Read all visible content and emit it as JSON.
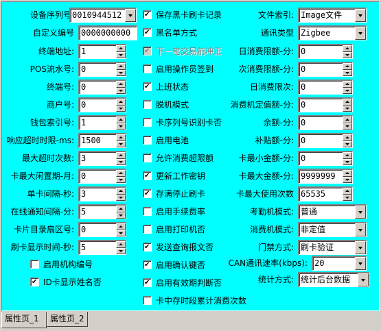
{
  "left_fields": [
    {
      "label": "设备序列号:",
      "value": "0010944512",
      "kind": "dropdown"
    },
    {
      "label": "自定义编号",
      "value": "0000000000",
      "kind": "text"
    },
    {
      "label": "终端地址:",
      "value": "1",
      "kind": "spin"
    },
    {
      "label": "POS流水号:",
      "value": "0",
      "kind": "spin"
    },
    {
      "label": "终端号:",
      "value": "0",
      "kind": "spin"
    },
    {
      "label": "商户号:",
      "value": "0",
      "kind": "spin"
    },
    {
      "label": "钱包索引号:",
      "value": "1",
      "kind": "spin"
    },
    {
      "label": "响应超时时限-ms:",
      "value": "1500",
      "kind": "spin"
    },
    {
      "label": "最大超时次数:",
      "value": "3",
      "kind": "spin"
    },
    {
      "label": "卡最大闲置期-月:",
      "value": "0",
      "kind": "spin"
    },
    {
      "label": "单卡间隔-秒:",
      "value": "3",
      "kind": "spin"
    },
    {
      "label": "在线通知间隔-分:",
      "value": "5",
      "kind": "spin"
    },
    {
      "label": "卡片目录扇区号:",
      "value": "0",
      "kind": "spin"
    },
    {
      "label": "刷卡显示时间-秒:",
      "value": "5",
      "kind": "spin"
    }
  ],
  "left_checkboxes": [
    {
      "label": "启用机构编号",
      "checked": false
    },
    {
      "label": "ID卡显示姓名否",
      "checked": true
    }
  ],
  "mid_checkboxes": [
    {
      "label": "保存黑卡刷卡记录",
      "checked": true,
      "disabled": false
    },
    {
      "label": "黑名单方式",
      "checked": true,
      "disabled": false
    },
    {
      "label": "下一笔交易前冲正",
      "checked": true,
      "disabled": true
    },
    {
      "label": "启用操作员签到",
      "checked": false,
      "disabled": false
    },
    {
      "label": "上班状态",
      "checked": true,
      "disabled": false
    },
    {
      "label": "脱机模式",
      "checked": false,
      "disabled": false
    },
    {
      "label": "卡序列号识别卡否",
      "checked": false,
      "disabled": false
    },
    {
      "label": "启用电池",
      "checked": false,
      "disabled": false
    },
    {
      "label": "允许消费超限额",
      "checked": false,
      "disabled": false
    },
    {
      "label": "更新工作密钥",
      "checked": true,
      "disabled": false
    },
    {
      "label": "存满停止刷卡",
      "checked": true,
      "disabled": false
    },
    {
      "label": "启用手续费率",
      "checked": false,
      "disabled": false
    },
    {
      "label": "启用打印机否",
      "checked": false,
      "disabled": false
    },
    {
      "label": "发送查询报文否",
      "checked": true,
      "disabled": false
    },
    {
      "label": "启用确认键否",
      "checked": true,
      "disabled": false
    },
    {
      "label": "启用有效期判断否",
      "checked": true,
      "disabled": false
    },
    {
      "label": "卡中存时段累计消费次数",
      "checked": false,
      "disabled": false
    }
  ],
  "right_fields": [
    {
      "label": "文件索引:",
      "value": "Image文件",
      "kind": "dropdown"
    },
    {
      "label": "通讯类型",
      "value": "Zigbee",
      "kind": "dropdown"
    },
    {
      "label": "日消费限额-分:",
      "value": "0",
      "kind": "spin"
    },
    {
      "label": "次消费限额-分:",
      "value": "0",
      "kind": "spin"
    },
    {
      "label": "日消费限次:",
      "value": "0",
      "kind": "spin"
    },
    {
      "label": "消费机定值额-分:",
      "value": "0",
      "kind": "spin"
    },
    {
      "label": "余额-分:",
      "value": "0",
      "kind": "spin"
    },
    {
      "label": "补贴额-分:",
      "value": "0",
      "kind": "spin"
    },
    {
      "label": "卡最小金额-分:",
      "value": "0",
      "kind": "spin"
    },
    {
      "label": "卡最大金额-分:",
      "value": "9999999",
      "kind": "spin"
    },
    {
      "label": "卡最大使用次数",
      "value": "65535",
      "kind": "spin"
    },
    {
      "label": "考勤机模式:",
      "value": "普通",
      "kind": "dropdown"
    },
    {
      "label": "消费机模式:",
      "value": "非定值",
      "kind": "dropdown"
    },
    {
      "label": "门禁方式:",
      "value": "刷卡验证",
      "kind": "dropdown"
    },
    {
      "label": "CAN通讯速率(kbps):",
      "value": "20",
      "kind": "dropdown"
    },
    {
      "label": "统计方式:",
      "value": "统计后台数据",
      "kind": "dropdown"
    }
  ],
  "tabs": [
    {
      "label": "属性页_1",
      "active": true
    },
    {
      "label": "属性页_2",
      "active": false
    }
  ]
}
